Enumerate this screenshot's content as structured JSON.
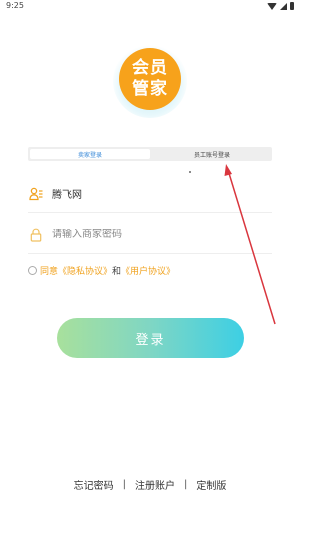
{
  "status_bar": {
    "time": "9:25"
  },
  "logo": {
    "line1": "会员",
    "line2": "管家"
  },
  "tabs": [
    {
      "label": "卖家登录",
      "active": true
    },
    {
      "label": "员工账号登录",
      "active": false
    }
  ],
  "form": {
    "account_value": "腾飞网",
    "password_placeholder": "请输入商家密码"
  },
  "agreement": {
    "prefix": "同意",
    "privacy": "《隐私协议》",
    "and": "和",
    "user": "《用户协议》"
  },
  "login_button": "登录",
  "footer": {
    "forgot": "忘记密码",
    "register": "注册账户",
    "custom": "定制版",
    "separator": "|"
  },
  "colors": {
    "accent": "#f0a21e",
    "tab_active": "#3b8ad8",
    "annotation": "#d9363e"
  }
}
